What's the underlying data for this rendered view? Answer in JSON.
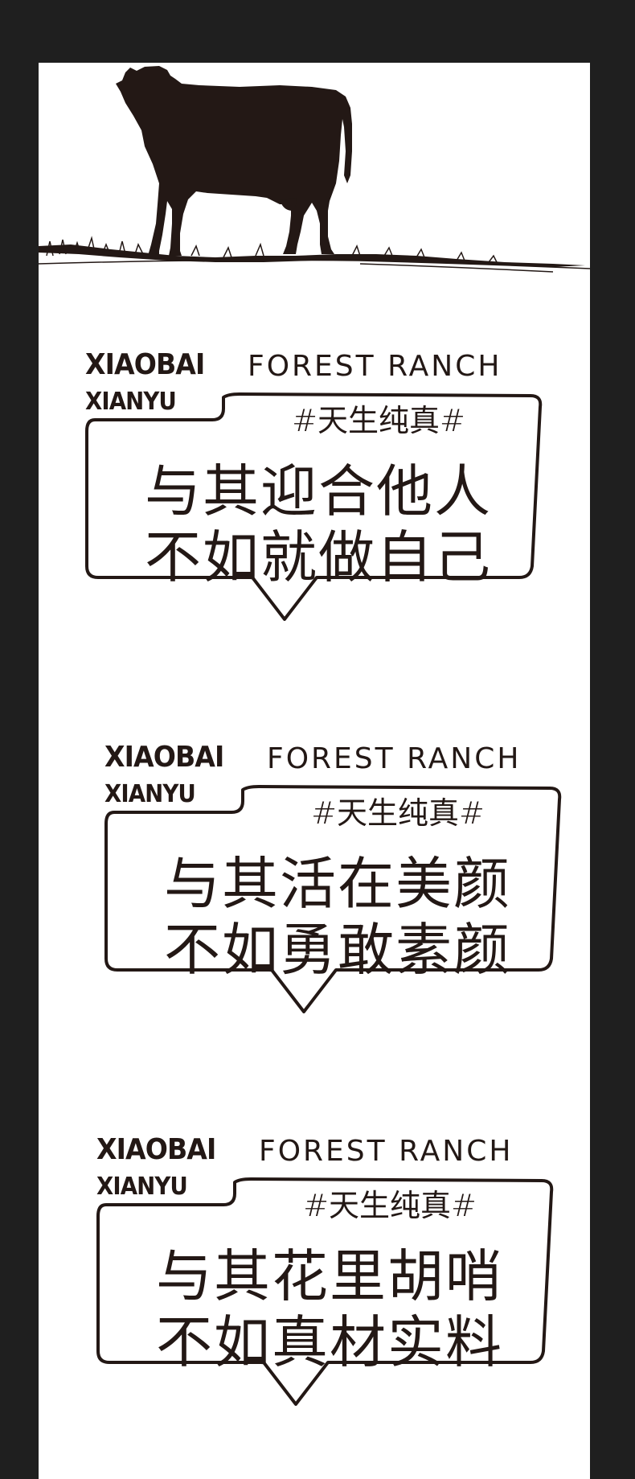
{
  "hero": {
    "illustration": "cow-silhouette-on-grass"
  },
  "cards": [
    {
      "brand_main": "XIAOBAI",
      "brand_sub": "FOREST RANCH",
      "brand_second": "XIANYU",
      "hashtag": "#天生纯真#",
      "line1": "与其迎合他人",
      "line2": "不如就做自己"
    },
    {
      "brand_main": "XIAOBAI",
      "brand_sub": "FOREST RANCH",
      "brand_second": "XIANYU",
      "hashtag": "#天生纯真#",
      "line1": "与其活在美颜",
      "line2": "不如勇敢素颜"
    },
    {
      "brand_main": "XIAOBAI",
      "brand_sub": "FOREST RANCH",
      "brand_second": "XIANYU",
      "hashtag": "#天生纯真#",
      "line1": "与其花里胡哨",
      "line2": "不如真材实料"
    }
  ],
  "colors": {
    "background": "#1f1f1f",
    "artboard": "#ffffff",
    "ink": "#231815"
  }
}
